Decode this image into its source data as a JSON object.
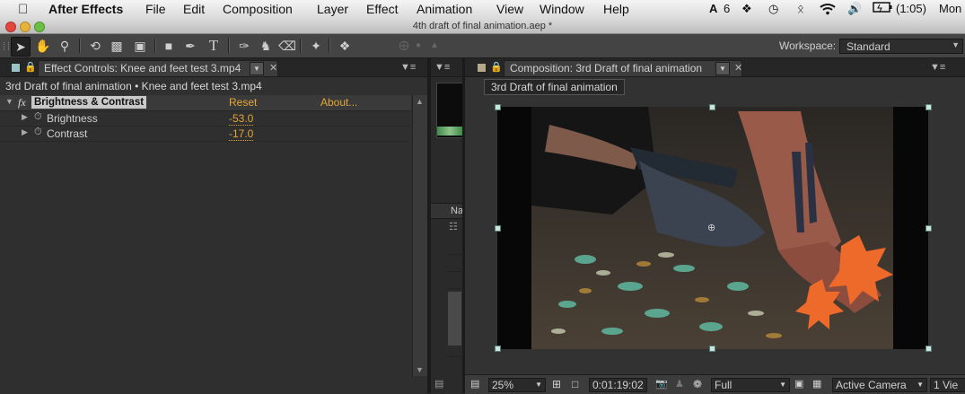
{
  "menubar": {
    "apple": "",
    "app_name": "After Effects",
    "items": [
      "File",
      "Edit",
      "Composition",
      "Layer",
      "Effect",
      "Animation",
      "View",
      "Window",
      "Help"
    ],
    "adobe_count": "6",
    "battery": "(1:05)",
    "clock": "Mon"
  },
  "window": {
    "title": "4th draft of final animation.aep *"
  },
  "toolbar": {
    "workspace_label": "Workspace:",
    "workspace_value": "Standard"
  },
  "effect_controls": {
    "tab_label": "Effect Controls: Knee and feet test 3.mp4",
    "breadcrumb": "3rd Draft of final animation • Knee and feet test 3.mp4",
    "effect_name": "Brightness & Contrast",
    "fx_label": "fx",
    "reset_label": "Reset",
    "about_label": "About...",
    "properties": [
      {
        "name": "Brightness",
        "value": "-53.0"
      },
      {
        "name": "Contrast",
        "value": "-17.0"
      }
    ]
  },
  "project": {
    "column_label": "Na"
  },
  "composition": {
    "tab_label": "Composition: 3rd Draft of final animation",
    "comp_name_badge": "3rd Draft of final animation"
  },
  "status_bar": {
    "zoom": "25%",
    "timecode": "0:01:19:02",
    "resolution": "Full",
    "camera": "Active Camera",
    "views": "1 Vie"
  },
  "colors": {
    "accent": "#e5a635",
    "panel_bg": "#2f2f2f",
    "handle": "#c8e6e0"
  }
}
